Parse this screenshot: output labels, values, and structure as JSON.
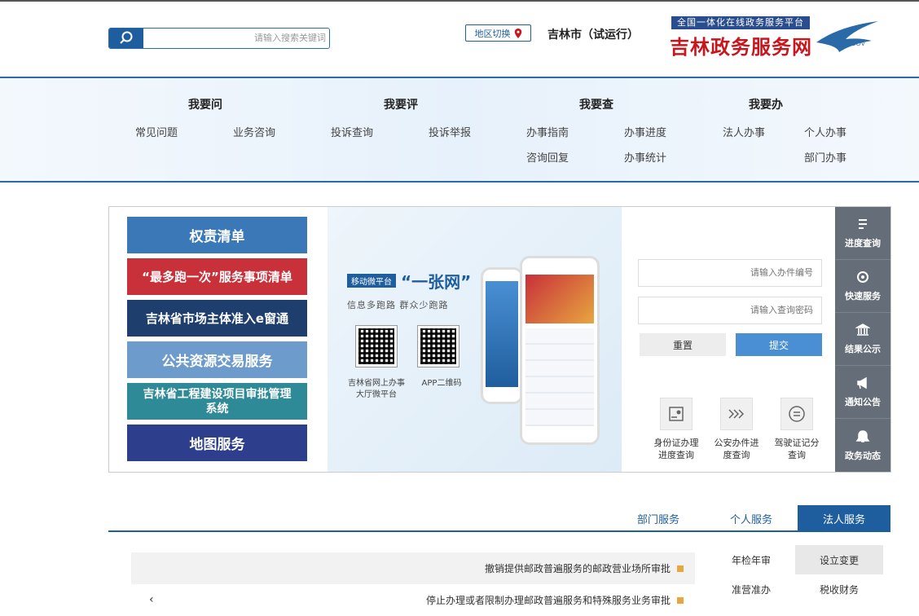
{
  "header": {
    "search_placeholder": "请输入搜索关键词",
    "region_button": "地区切换",
    "city_label": "吉林市（试运行）",
    "logo_sub": "全国一体化在线政务服务平台",
    "logo_main": "吉林政务服务网"
  },
  "nav": {
    "cols": [
      {
        "title": "我要办",
        "items": [
          "个人办事",
          "法人办事",
          "部门办事"
        ]
      },
      {
        "title": "我要查",
        "items": [
          "办事进度",
          "办事指南",
          "办事统计",
          "咨询回复"
        ]
      },
      {
        "title": "我要评",
        "items": [
          "投诉举报",
          "投诉查询"
        ]
      },
      {
        "title": "我要问",
        "items": [
          "业务咨询",
          "常见问题"
        ]
      }
    ]
  },
  "side_menu": [
    "进度查询",
    "快速服务",
    "结果公示",
    "通知公告",
    "政务动态"
  ],
  "query": {
    "code_placeholder": "请输入办件编号",
    "pwd_placeholder": "请输入查询密码",
    "submit": "提交",
    "reset": "重置",
    "cards": [
      {
        "label1": "驾驶证记分",
        "label2": "查询"
      },
      {
        "label1": "公安办件进",
        "label2": "度查询"
      },
      {
        "label1": "身份证办理",
        "label2": "进度查询"
      }
    ]
  },
  "promo": {
    "title": "“一张网”",
    "tag": "移动微平台",
    "subtitle": "信息多跑路 群众少跑路",
    "qr1_label": "APP二维码",
    "qr2_label1": "吉林省网上办事",
    "qr2_label2": "大厅微平台"
  },
  "categories": [
    {
      "label": "权责清单",
      "color": "#3a78b8"
    },
    {
      "label": "“最多跑一次”服务事项清单",
      "color": "#c8303a"
    },
    {
      "label": "吉林省市场主体准入e窗通",
      "color": "#1e3f6e"
    },
    {
      "label": "公共资源交易服务",
      "color": "#6d9ccc"
    },
    {
      "label": "吉林省工程建设项目审批管理系统",
      "color": "#2f8a98"
    },
    {
      "label": "地图服务",
      "color": "#2d3f8c"
    }
  ],
  "tabs": [
    "法人服务",
    "个人服务",
    "部门服务"
  ],
  "sub_cats": [
    "设立变更",
    "年检年审",
    "税收财务",
    "准营准办"
  ],
  "items": [
    "撤销提供邮政普遍服务的邮政营业场所审批",
    "停止办理或者限制办理邮政普遍服务和特殊服务业务审批"
  ]
}
